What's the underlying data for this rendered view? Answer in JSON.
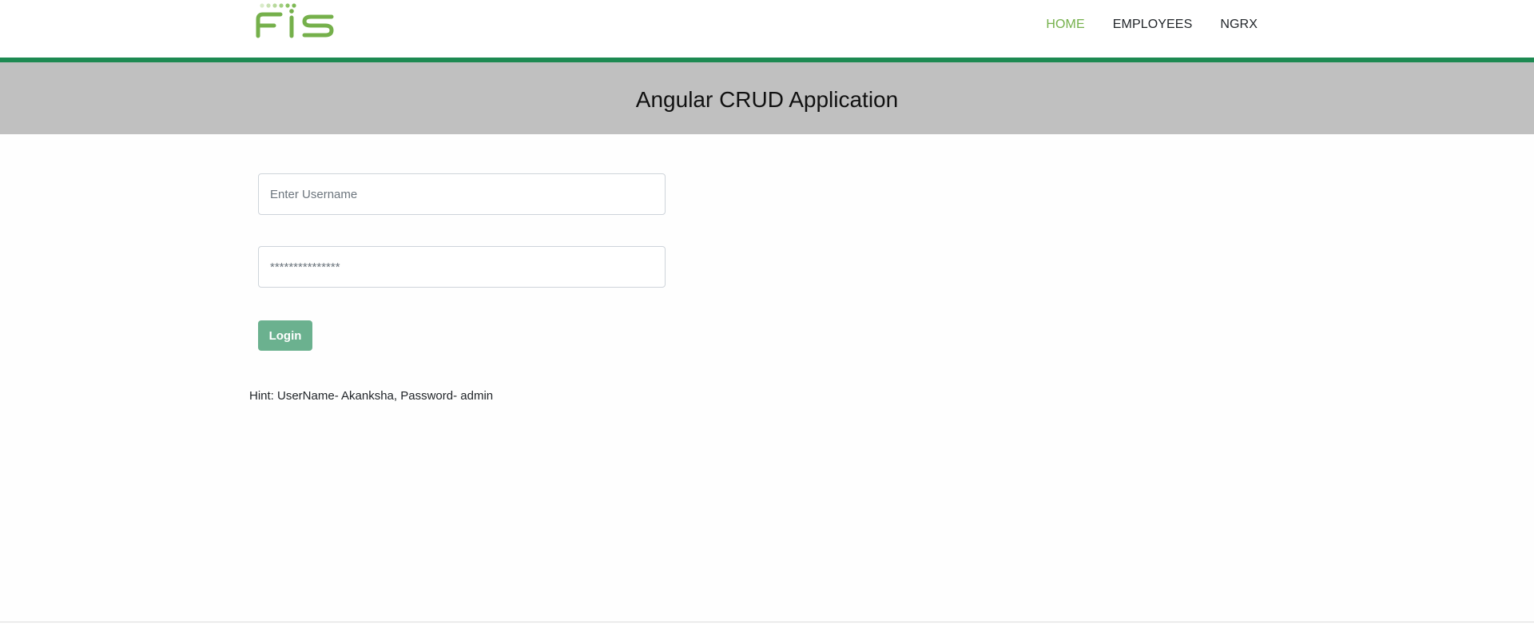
{
  "brand": {
    "logo_text": "FIS",
    "logo_icon": "fis-logo-icon",
    "brand_color": "#75b04b"
  },
  "nav": {
    "items": [
      {
        "label": "HOME",
        "active": true
      },
      {
        "label": "EMPLOYEES",
        "active": false
      },
      {
        "label": "NGRX",
        "active": false
      }
    ],
    "active_color": "#75b04b",
    "border_color": "#1d8a52"
  },
  "banner": {
    "title": "Angular CRUD Application",
    "background": "#c0c0c0"
  },
  "login_form": {
    "username": {
      "value": "",
      "placeholder": "Enter Username"
    },
    "password": {
      "value": "",
      "placeholder": "***************"
    },
    "login_label": "Login",
    "button_color": "#6bb18f"
  },
  "hint": {
    "text": "Hint: UserName- Akanksha, Password- admin"
  }
}
